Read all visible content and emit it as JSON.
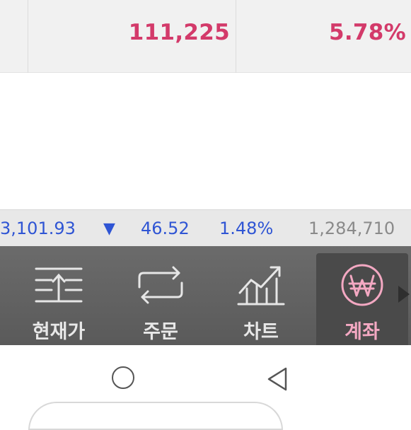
{
  "table": {
    "row": {
      "value": "111,225",
      "percent": "5.78%"
    }
  },
  "ticker": {
    "index": "3,101.93",
    "direction_icon": "down-triangle-icon",
    "change": "46.52",
    "change_pct": "1.48%",
    "volume": "1,284,710"
  },
  "tabs": [
    {
      "label": "현재가",
      "icon": "current-price-icon",
      "active": false
    },
    {
      "label": "주문",
      "icon": "order-exchange-icon",
      "active": false
    },
    {
      "label": "차트",
      "icon": "chart-icon",
      "active": false
    },
    {
      "label": "계좌",
      "icon": "won-account-icon",
      "active": true
    }
  ],
  "colors": {
    "up": "#d33a6a",
    "down": "#2f55d4",
    "volume": "#8a8a8a",
    "tabbar": "#616161",
    "active_tab": "#f3a8c2"
  }
}
